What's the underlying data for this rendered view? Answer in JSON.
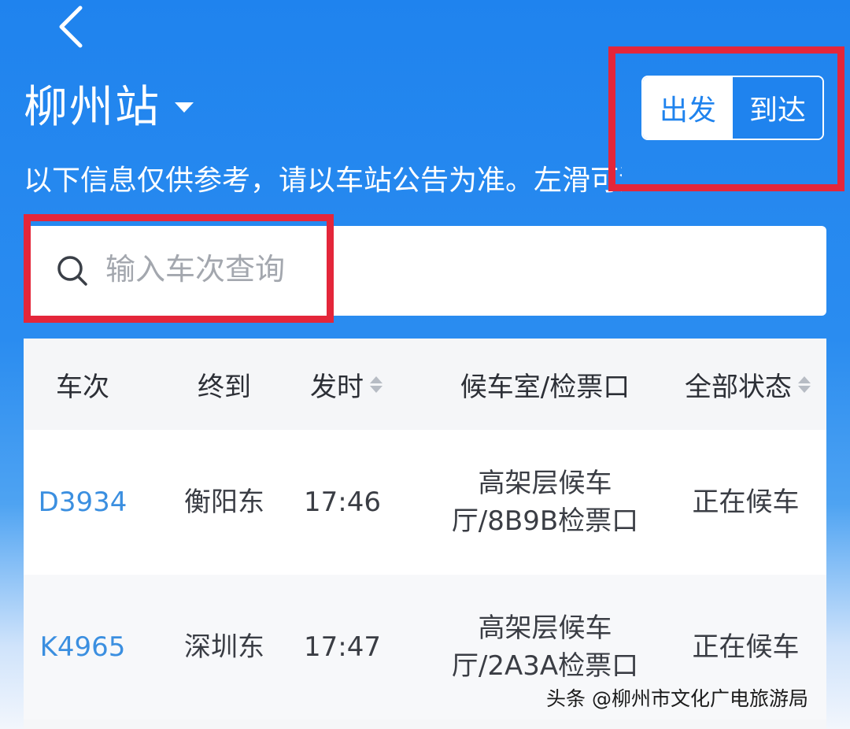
{
  "header": {
    "back_icon": "chevron-left-icon",
    "station_name": "柳州站",
    "dropdown_icon": "caret-down-icon",
    "toggle": {
      "departure": "出发",
      "arrival": "到达",
      "active": "到达"
    },
    "notice": "以下信息仅供参考，请以车站公告为准。左滑可添加关注"
  },
  "search": {
    "icon": "search-icon",
    "placeholder": "输入车次查询",
    "value": ""
  },
  "table": {
    "headers": [
      "车次",
      "终到",
      "发时",
      "候车室/检票口",
      "全部状态"
    ],
    "rows": [
      {
        "train": "D3934",
        "terminal": "衡阳东",
        "time": "17:46",
        "waiting_line1": "高架层候车",
        "waiting_line2": "厅/8B9B检票口",
        "status": "正在候车"
      },
      {
        "train": "K4965",
        "terminal": "深圳东",
        "time": "17:47",
        "waiting_line1": "高架层候车",
        "waiting_line2": "厅/2A3A检票口",
        "status": "正在候车"
      }
    ]
  },
  "watermark": "头条 @柳州市文化广电旅游局",
  "colors": {
    "primary": "#1f83ee",
    "highlight_box": "#e4263a",
    "train_link": "#3b8fe0"
  }
}
